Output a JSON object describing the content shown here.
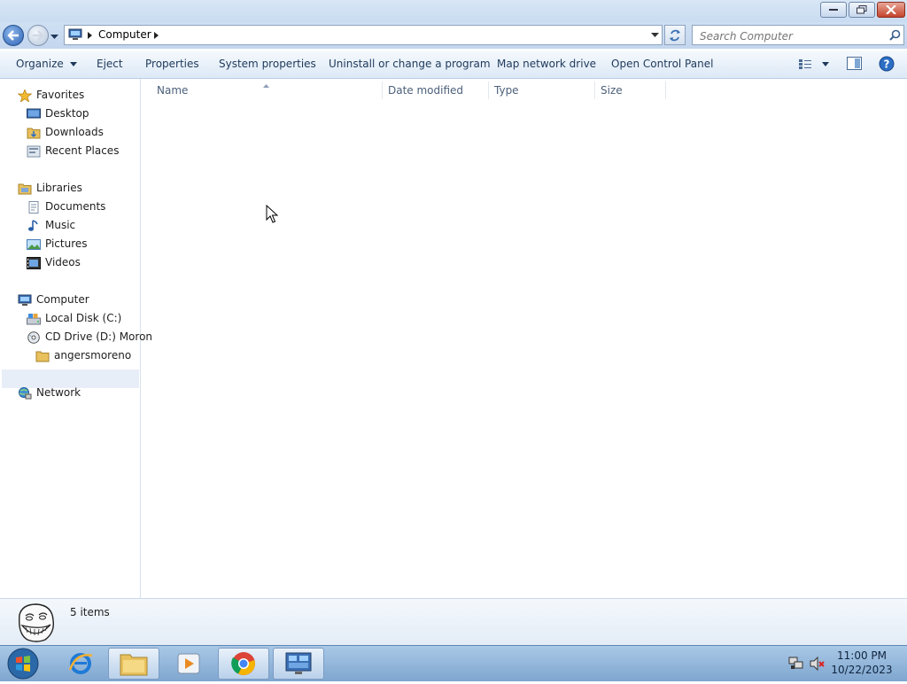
{
  "address": {
    "path_label": "Computer",
    "search_placeholder": "Search Computer"
  },
  "toolbar": {
    "organize": "Organize",
    "eject": "Eject",
    "properties": "Properties",
    "system_properties": "System properties",
    "uninstall": "Uninstall or change a program",
    "map_network_drive": "Map network drive",
    "open_control_panel": "Open Control Panel"
  },
  "nav": {
    "favorites": "Favorites",
    "desktop": "Desktop",
    "downloads": "Downloads",
    "recent_places": "Recent Places",
    "libraries": "Libraries",
    "documents": "Documents",
    "music": "Music",
    "pictures": "Pictures",
    "videos": "Videos",
    "computer": "Computer",
    "local_disk": "Local Disk (C:)",
    "cd_drive": "CD Drive (D:) Moron",
    "cd_folder": "angersmoreno",
    "network": "Network"
  },
  "columns": {
    "name": "Name",
    "date_modified": "Date modified",
    "type": "Type",
    "size": "Size"
  },
  "status": {
    "item_count": "5 items"
  },
  "taskbar": {
    "time": "11:00 PM",
    "date": "10/22/2023"
  },
  "colors": {
    "accent": "#1e395b",
    "titlebar": "#c9dcf1",
    "taskbar": "#7fa6cf"
  },
  "icons": [
    "back-icon",
    "forward-icon",
    "computer-icon",
    "refresh-icon",
    "search-icon",
    "view-icon",
    "preview-pane-icon",
    "help-icon",
    "star-icon",
    "folder-icon",
    "drive-icon",
    "cd-icon",
    "network-icon",
    "troll-face-icon",
    "start-orb-icon",
    "ie-icon",
    "explorer-icon",
    "media-icon",
    "chrome-icon",
    "control-panel-icon",
    "network-tray-icon",
    "mute-icon"
  ]
}
